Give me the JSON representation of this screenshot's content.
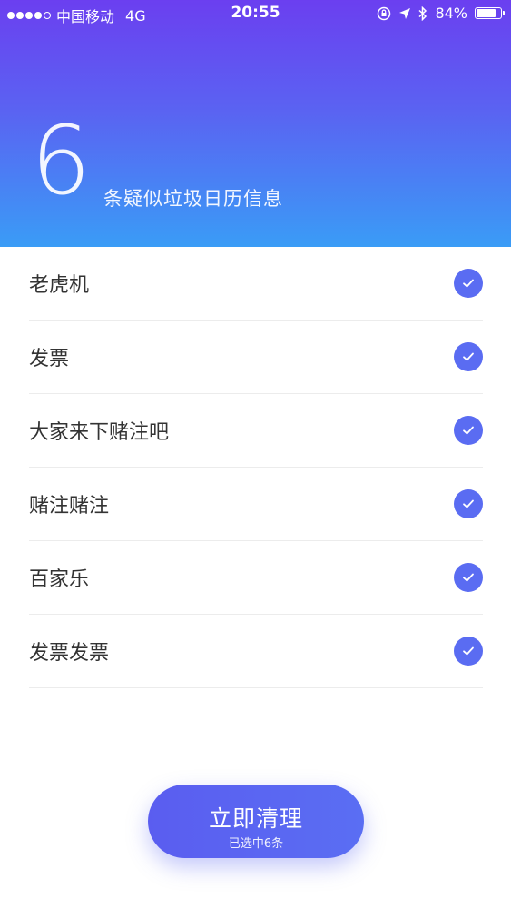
{
  "status_bar": {
    "carrier": "中国移动",
    "network": "4G",
    "time": "20:55",
    "battery_text": "84%",
    "battery_level": 0.84,
    "signal_bars_filled": 4,
    "signal_bars_total": 5,
    "icons": [
      "lock-rotation-icon",
      "location-arrow-icon",
      "bluetooth-icon",
      "battery-icon"
    ]
  },
  "header": {
    "count": "6",
    "count_label": "条疑似垃圾日历信息",
    "gradient_colors": [
      "#6b3ff0",
      "#5a63f2",
      "#3a9cf6"
    ]
  },
  "items": [
    {
      "label": "老虎机",
      "checked": true
    },
    {
      "label": "发票",
      "checked": true
    },
    {
      "label": "大家来下赌注吧",
      "checked": true
    },
    {
      "label": "赌注赌注",
      "checked": true
    },
    {
      "label": "百家乐",
      "checked": true
    },
    {
      "label": "发票发票",
      "checked": true
    }
  ],
  "action_button": {
    "label": "立即清理",
    "sublabel": "已选中6条"
  },
  "colors": {
    "accent": "#5a6cf2",
    "text": "#333333",
    "divider": "#ececec"
  }
}
